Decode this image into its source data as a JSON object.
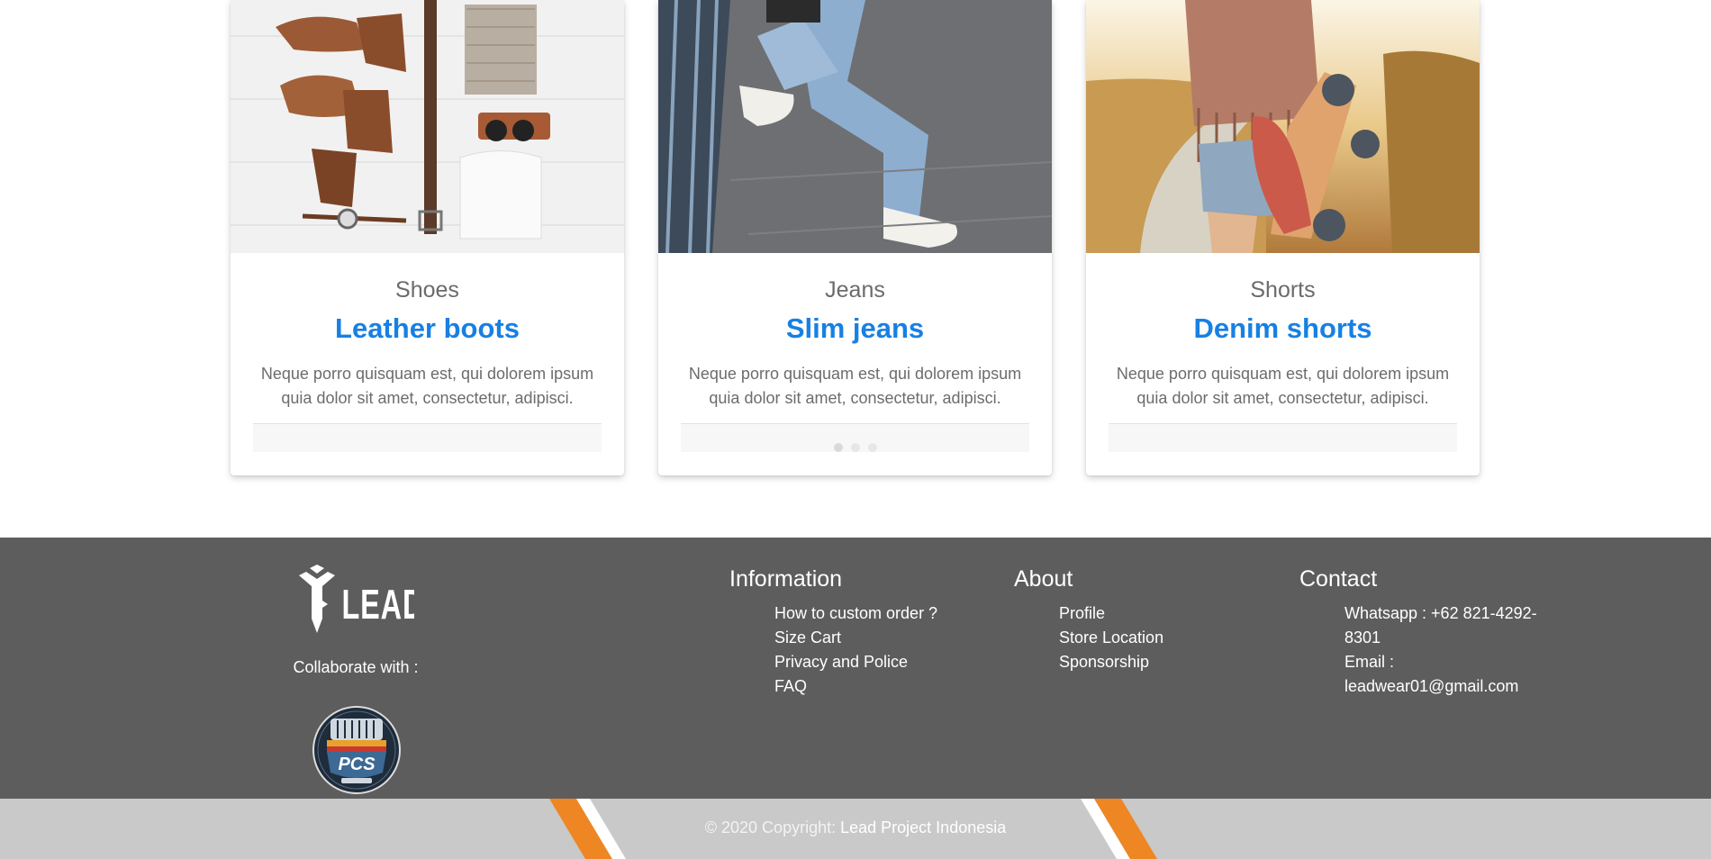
{
  "cards": [
    {
      "category": "Shoes",
      "title": "Leather boots",
      "description": "Neque porro quisquam est, qui dolorem ipsum quia dolor sit amet, consectetur, adipisci."
    },
    {
      "category": "Jeans",
      "title": "Slim jeans",
      "description": "Neque porro quisquam est, qui dolorem ipsum quia dolor sit amet, consectetur, adipisci."
    },
    {
      "category": "Shorts",
      "title": "Denim shorts",
      "description": "Neque porro quisquam est, qui dolorem ipsum quia dolor sit amet, consectetur, adipisci."
    }
  ],
  "carousel": {
    "slides": 3,
    "active": 1
  },
  "footer": {
    "brand_logo": "LEAD",
    "collaborate_label": "Collaborate with :",
    "partner_logo_text": "PCS",
    "information": {
      "heading": "Information",
      "links": [
        "How to custom order ?",
        "Size Cart",
        "Privacy and Police",
        "FAQ"
      ]
    },
    "about": {
      "heading": "About",
      "links": [
        "Profile",
        "Store Location",
        "Sponsorship"
      ]
    },
    "contact": {
      "heading": "Contact",
      "whatsapp": "Whatsapp : +62 821-4292-8301",
      "email_label": "Email :",
      "email": "leadwear01@gmail.com"
    }
  },
  "copyright": {
    "prefix": "© 2020 Copyright: ",
    "brand": "Lead Project Indonesia"
  },
  "colors": {
    "accent": "#1780e3",
    "footer_bg": "#5e5d5e",
    "copyright_bg": "#c8c9c8",
    "stripe_orange": "#ee8623"
  }
}
